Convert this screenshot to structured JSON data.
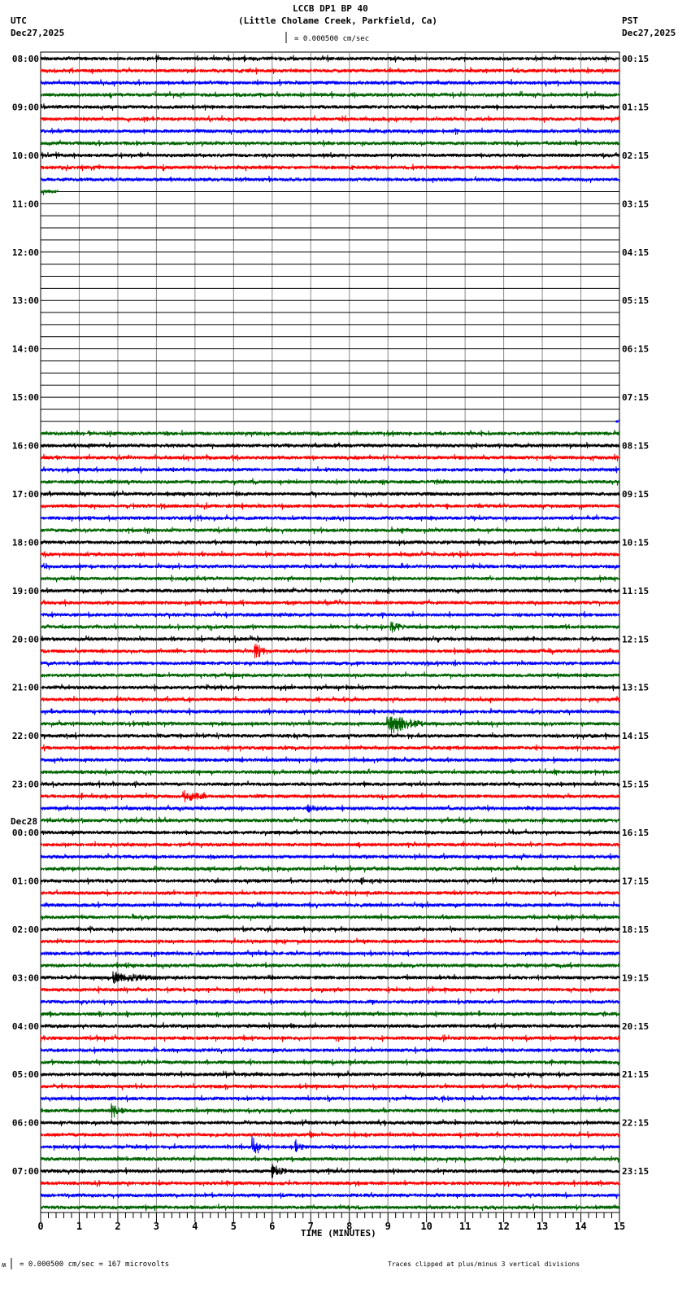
{
  "header": {
    "title": "LCCB DP1 BP 40",
    "subtitle": "(Little Cholame Creek, Parkfield, Ca)",
    "left_tz": "UTC",
    "left_date": "Dec27,2025",
    "right_tz": "PST",
    "right_date": "Dec27,2025",
    "scale": "= 0.000500 cm/sec"
  },
  "footer": {
    "scale_prefix": "ʍ",
    "scale": "= 0.000500 cm/sec =     167 microvolts",
    "clip_note": "Traces clipped at plus/minus 3 vertical divisions"
  },
  "chart_data": {
    "type": "line",
    "title": "LCCB DP1 BP 40",
    "xlabel": "TIME (MINUTES)",
    "xlim": [
      0,
      15
    ],
    "x_ticks": [
      "0",
      "1",
      "2",
      "3",
      "4",
      "5",
      "6",
      "7",
      "8",
      "9",
      "10",
      "11",
      "12",
      "13",
      "14",
      "15"
    ],
    "utc_labels": [
      "08:00",
      "09:00",
      "10:00",
      "11:00",
      "12:00",
      "13:00",
      "14:00",
      "15:00",
      "16:00",
      "17:00",
      "18:00",
      "19:00",
      "20:00",
      "21:00",
      "22:00",
      "23:00",
      "00:00",
      "01:00",
      "02:00",
      "03:00",
      "04:00",
      "05:00",
      "06:00",
      "07:00"
    ],
    "date_change": {
      "label": "Dec28",
      "at_hour_index": 16
    },
    "pst_labels": [
      "00:15",
      "01:15",
      "02:15",
      "03:15",
      "04:15",
      "05:15",
      "06:15",
      "07:15",
      "08:15",
      "09:15",
      "10:15",
      "11:15",
      "12:15",
      "13:15",
      "14:15",
      "15:15",
      "16:15",
      "17:15",
      "18:15",
      "19:15",
      "20:15",
      "21:15",
      "22:15",
      "23:15"
    ],
    "traces_per_hour": 4,
    "trace_colors": [
      "#000000",
      "#ff0000",
      "#0000ff",
      "#006400"
    ],
    "gap": {
      "partial_trace": 11,
      "partial_end_min": 0.45,
      "empty_from": 12,
      "empty_to": 30,
      "trace30_start_min": 14.9
    },
    "events": [
      {
        "trace": 47,
        "minute": 9.1,
        "amplitude": 1.2,
        "duration": 0.4
      },
      {
        "trace": 49,
        "minute": 5.55,
        "amplitude": 3,
        "duration": 0.3
      },
      {
        "trace": 55,
        "minute": 9.0,
        "amplitude": 3,
        "duration": 0.9
      },
      {
        "trace": 61,
        "minute": 3.7,
        "amplitude": 1.5,
        "duration": 0.6
      },
      {
        "trace": 62,
        "minute": 6.9,
        "amplitude": 0.8,
        "duration": 0.5
      },
      {
        "trace": 76,
        "minute": 1.9,
        "amplitude": 1.3,
        "duration": 1.2
      },
      {
        "trace": 87,
        "minute": 1.85,
        "amplitude": 1.8,
        "duration": 0.35
      },
      {
        "trace": 89,
        "minute": 7.0,
        "amplitude": 0.8,
        "duration": 0.1
      },
      {
        "trace": 90,
        "minute": 5.5,
        "amplitude": 3,
        "duration": 0.2
      },
      {
        "trace": 90,
        "minute": 6.6,
        "amplitude": 1.2,
        "duration": 0.3
      },
      {
        "trace": 92,
        "minute": 6.0,
        "amplitude": 1.6,
        "duration": 0.4
      }
    ]
  }
}
